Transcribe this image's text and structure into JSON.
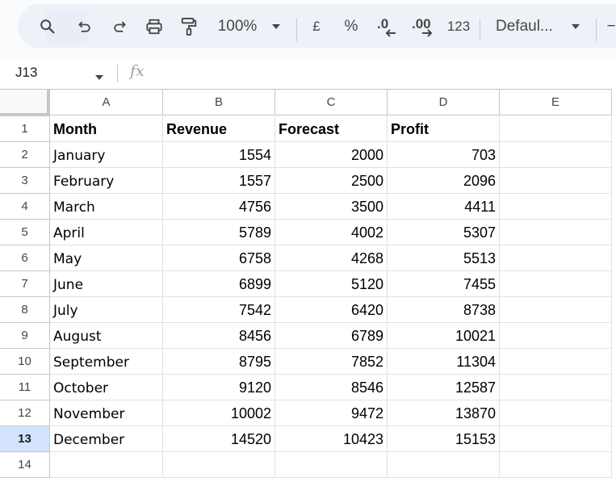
{
  "toolbar": {
    "zoom_value": "100%",
    "currency_label": "£",
    "percent_label": "%",
    "decrease_decimal_label": ".0",
    "increase_decimal_label": ".00",
    "number_format_label": "123",
    "font_name": "Defaul...",
    "font_size_minus": "−"
  },
  "formula_bar": {
    "name_box": "J13",
    "fx_label": "fx",
    "formula": ""
  },
  "grid": {
    "columns": [
      "A",
      "B",
      "C",
      "D",
      "E"
    ],
    "rows": [
      "1",
      "2",
      "3",
      "4",
      "5",
      "6",
      "7",
      "8",
      "9",
      "10",
      "11",
      "12",
      "13",
      "14"
    ],
    "selected_row": "13",
    "header_row": [
      "Month",
      "Revenue",
      "Forecast",
      "Profit",
      ""
    ],
    "data": [
      {
        "month": "January",
        "revenue": "1554",
        "forecast": "2000",
        "profit": "703"
      },
      {
        "month": "February",
        "revenue": "1557",
        "forecast": "2500",
        "profit": "2096"
      },
      {
        "month": "March",
        "revenue": "4756",
        "forecast": "3500",
        "profit": "4411"
      },
      {
        "month": "April",
        "revenue": "5789",
        "forecast": "4002",
        "profit": "5307"
      },
      {
        "month": "May",
        "revenue": "6758",
        "forecast": "4268",
        "profit": "5513"
      },
      {
        "month": "June",
        "revenue": "6899",
        "forecast": "5120",
        "profit": "7455"
      },
      {
        "month": "July",
        "revenue": "7542",
        "forecast": "6420",
        "profit": "8738"
      },
      {
        "month": "August",
        "revenue": "8456",
        "forecast": "6789",
        "profit": "10021"
      },
      {
        "month": "September",
        "revenue": "8795",
        "forecast": "7852",
        "profit": "11304"
      },
      {
        "month": "October",
        "revenue": "9120",
        "forecast": "8546",
        "profit": "12587"
      },
      {
        "month": "November",
        "revenue": "10002",
        "forecast": "9472",
        "profit": "13870"
      },
      {
        "month": "December",
        "revenue": "14520",
        "forecast": "10423",
        "profit": "15153"
      }
    ]
  },
  "colors": {
    "toolbar_bg": "#eef2f8",
    "selected_row_header": "#d3e3fd",
    "gridline": "#e1e1e1",
    "header_border": "#c4c7c5"
  }
}
